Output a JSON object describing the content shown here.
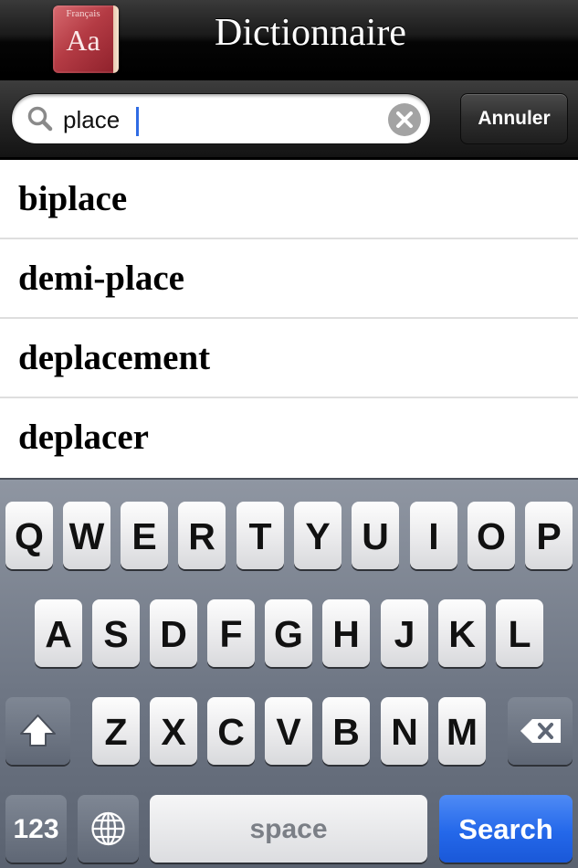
{
  "header": {
    "app_icon": {
      "language": "Français",
      "letters": "Aa"
    },
    "title": "Dictionnaire"
  },
  "search": {
    "value": "place",
    "placeholder": "",
    "cancel_label": "Annuler",
    "icons": {
      "search": "magnifier-icon",
      "clear": "clear-x-icon"
    }
  },
  "results": [
    {
      "word": "biplace"
    },
    {
      "word": "demi-place"
    },
    {
      "word": "deplacement"
    },
    {
      "word": "deplacer"
    }
  ],
  "keyboard": {
    "row1": [
      "Q",
      "W",
      "E",
      "R",
      "T",
      "Y",
      "U",
      "I",
      "O",
      "P"
    ],
    "row2": [
      "A",
      "S",
      "D",
      "F",
      "G",
      "H",
      "J",
      "K",
      "L"
    ],
    "row3": [
      "Z",
      "X",
      "C",
      "V",
      "B",
      "N",
      "M"
    ],
    "numbers_label": "123",
    "space_label": "space",
    "search_label": "Search",
    "icons": {
      "shift": "shift-arrow-icon",
      "delete": "backspace-icon",
      "globe": "globe-icon"
    },
    "colors": {
      "search_key": "#2468ea",
      "modifier_key": "#6a7280"
    }
  }
}
